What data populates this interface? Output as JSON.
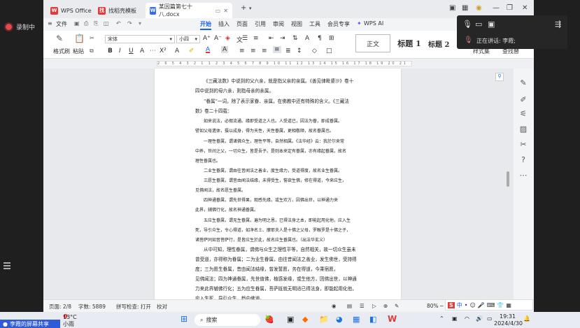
{
  "recording": {
    "label": "录制中"
  },
  "tabs": [
    {
      "label": "WPS Office",
      "icon_color": "#e03a3a",
      "icon": "W"
    },
    {
      "label": "找稻壳模板",
      "icon_color": "#e03a3a",
      "icon": "找"
    },
    {
      "label": "某因篇第七十八.docx",
      "icon_color": "#2f6df6",
      "icon": "W"
    }
  ],
  "menubar": {
    "file": "文件",
    "items": [
      "开始",
      "插入",
      "页面",
      "引用",
      "审阅",
      "视图",
      "工具",
      "会员专享"
    ],
    "active": "开始",
    "wps_ai": "WPS AI"
  },
  "ribbon": {
    "format_painter": "格式刷",
    "paste": "粘贴",
    "font_name": "宋体",
    "font_size": "小四",
    "styles": [
      "正文",
      "标题 1",
      "标题 2"
    ],
    "style_set": "样式集",
    "find_replace": "查找替"
  },
  "ruler": {
    "numbers": "2 6 5 4 3 2 1  1 2 3 4 5 6 7 8 9 10 11 12 13 14 15 16 17 18 19 20 21 22 23 24 25 26 27 28 29 30 31 32 33 34 35 36 37 38 40 42 44 46"
  },
  "document": {
    "paragraphs": [
      "《三藏法数》中说到的父六亲，就是指父亲的亲属。《善见律毗婆沙》卷十",
      "四中说到的母六亲，则指母亲的亲属。",
      "“眷属”一词，除了表示家眷、亲属，在佛教中还有特殊的含义。《三藏法",
      "数》卷二十四载：",
      "如来说法，必假流通。缘即受道之人也。人受道已，因法为眷，即成眷属。",
      "譬如父母遗体，摄以成身，得为天性，天性眷属，更相敬顺，故名眷属也。",
      "一理性眷属，谓诸佛众生，理性平等，自然相属。《法华经》云：我於尔来常",
      "中养，世间之父，一切众生，皆是吾子。是则本来定有眷属，亦有缘起眷属，故名",
      "理性眷属也。",
      "二业生眷属，谓由往昔闻法之善业，度生缘力，受道得度，故名业生眷属。",
      "三愿生眷属，谓昔由闻法结缘，未得受生，誓欲生佛，修在得道，今来应生，",
      "见佛闻法，故名愿生眷属。",
      "四神通眷属，谓先世得果，观感先缘，或生欢方，因佛出世，以神通力来",
      "此界，辅佛行化，故名神通眷属。",
      "五应生眷属，谓无生眷属，遍为明之恩，已得法身之本，即能起用化他，应入生",
      "死，导引众生，令心得道，如净名土、摩耶夫人是十佛之父母，罗睺罗是十佛之子，",
      "诸菩萨同如音菩萨行，是皆应生於此，故名应生眷属也。（出法华玄义）",
      "从中可知，理性眷属，谓佛与众生之理性平等，自然相关，故一切众生虽未",
      "曾受道，亦得称为眷属；二为业生眷属，由往昔闻法之善业，发生佛世，受持得",
      "度；三为愿生眷属，昔由闻法结缘，曾发誓愿，务在得道，今乘宿愿，",
      "见佛闻法；四为神通眷属，先世值佛，植感发缘，或生他方，因佛出世，以神通",
      "力来此界辅佛行化；五为应生眷属，菩萨既就无明适已得法身，即能起用化他，",
      "应入生死，导引众生，趋向佛道。"
    ]
  },
  "statusbar": {
    "page": "页面: 2/8",
    "words": "字数: 5889",
    "spellcheck": "拼写检查: 打开",
    "proofread": "校对",
    "zoom": "80%"
  },
  "call": {
    "speaking_label": "正在讲话: 李霞;"
  },
  "taskbar": {
    "share_notice": "李霞的屏幕共享",
    "weather_temp": "13°C",
    "weather_desc": "小雨",
    "search": "搜索",
    "time": "19:31",
    "date": "2024/4/30"
  },
  "colors": {
    "accent": "#1a5ff5",
    "record": "#e5484d",
    "wps_red": "#e03a3a"
  }
}
